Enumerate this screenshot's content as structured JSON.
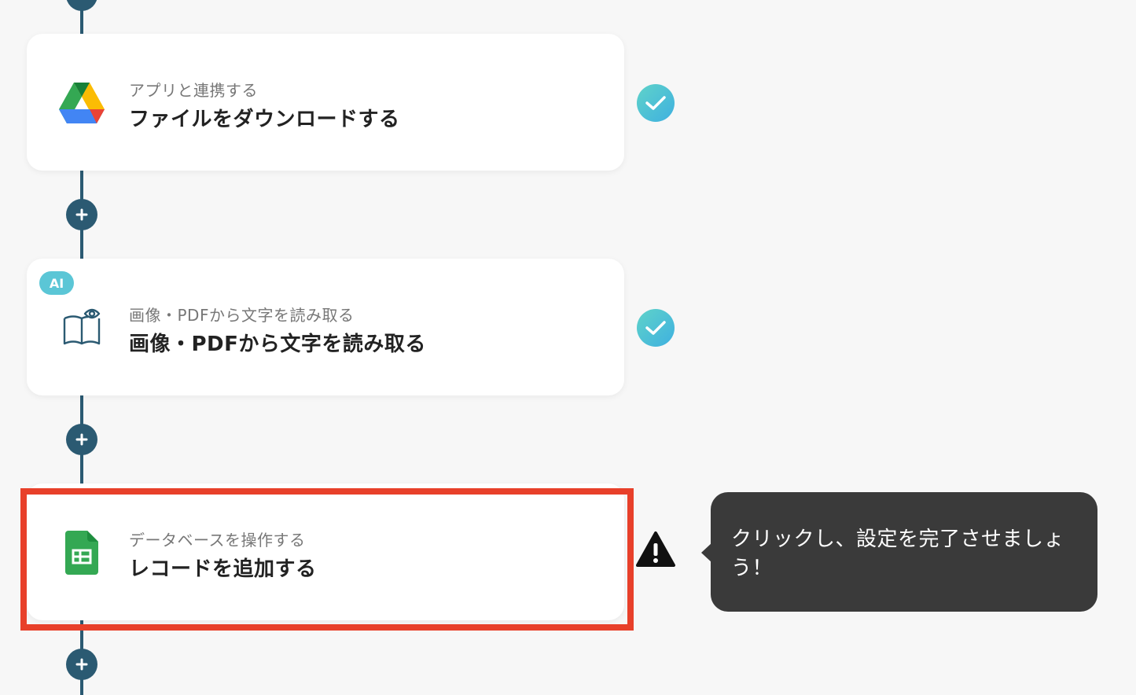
{
  "steps": [
    {
      "subtitle": "アプリと連携する",
      "title": "ファイルをダウンロードする",
      "icon": "google-drive-icon",
      "status": "complete"
    },
    {
      "badge": "AI",
      "subtitle": "画像・PDFから文字を読み取る",
      "title": "画像・PDFから文字を読み取る",
      "icon": "book-eye-icon",
      "status": "complete"
    },
    {
      "subtitle": "データベースを操作する",
      "title": "レコードを追加する",
      "icon": "google-sheets-icon",
      "status": "warning"
    }
  ],
  "tooltip": {
    "text": "クリックし、設定を完了させましょう！"
  },
  "colors": {
    "connector": "#2b5a72",
    "highlight": "#e8402a",
    "check_gradient": [
      "#5fd3c9",
      "#3fb0e0"
    ],
    "ai_badge": "#5bc6d6",
    "tooltip_bg": "#3a3a3a"
  }
}
